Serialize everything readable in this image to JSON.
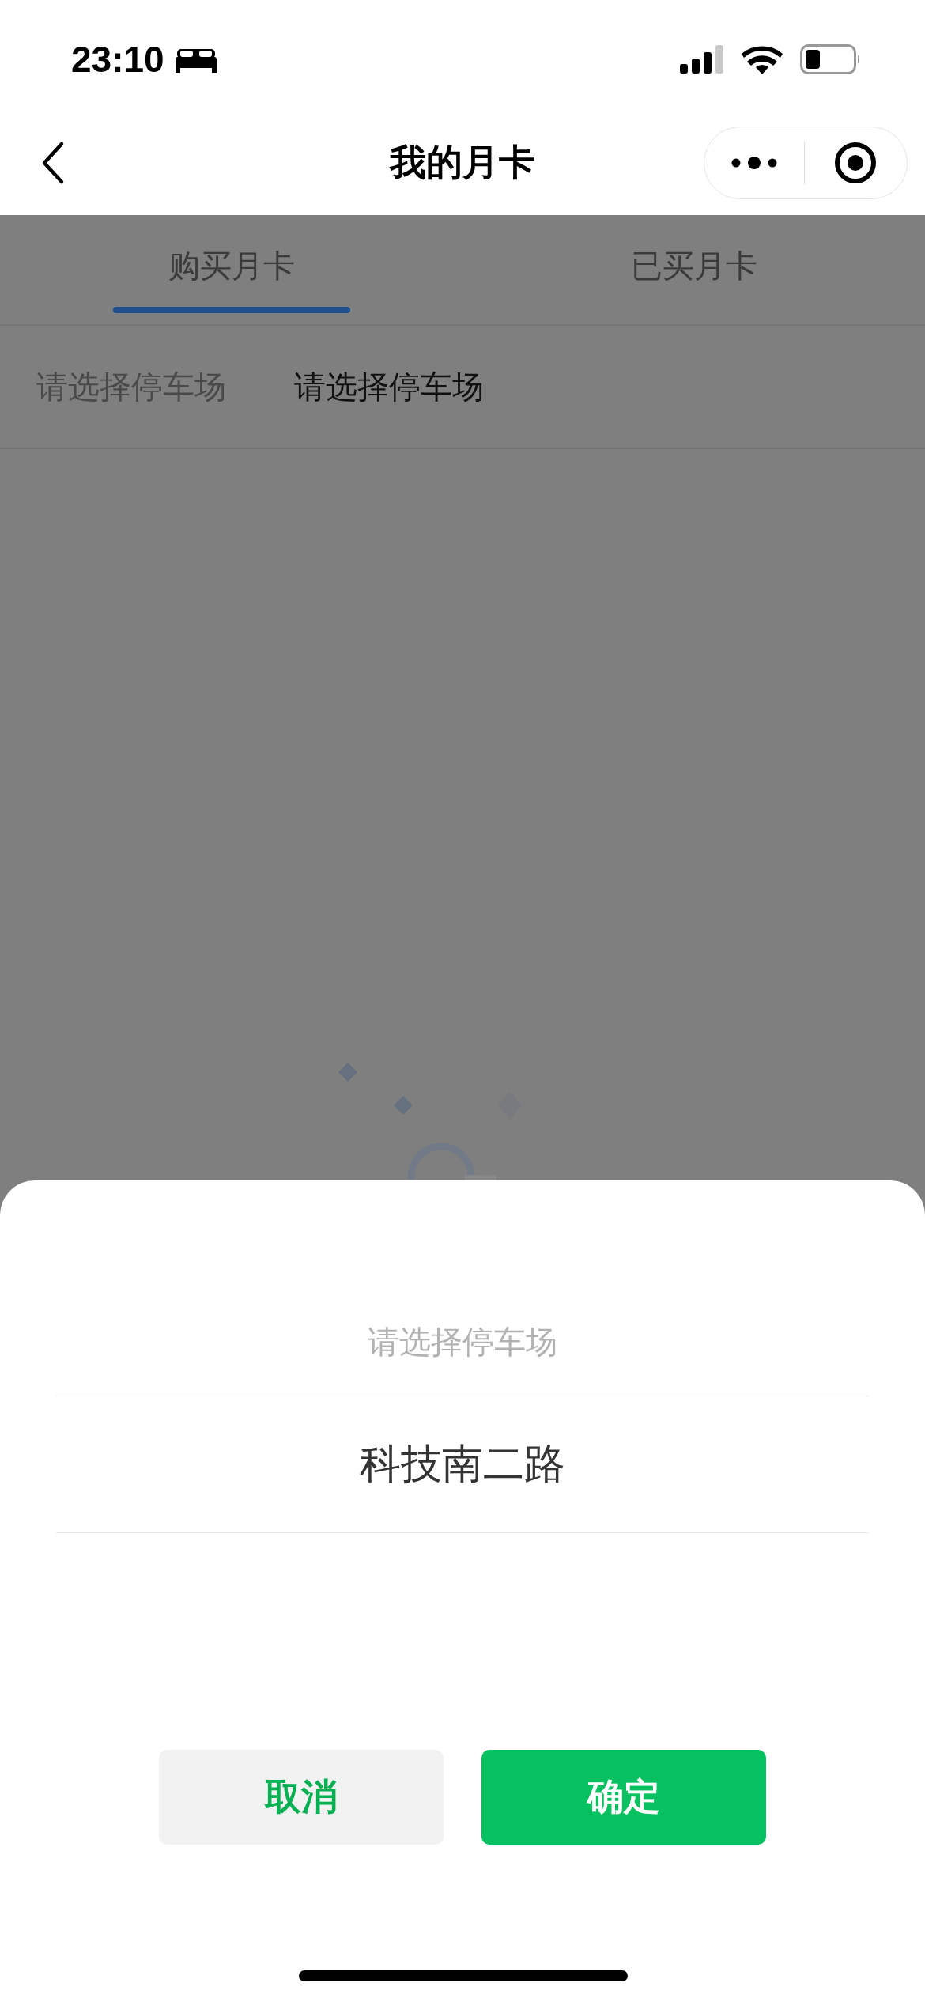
{
  "status_bar": {
    "time": "23:10"
  },
  "nav": {
    "title": "我的月卡"
  },
  "tabs": [
    {
      "label": "购买月卡",
      "selected": true
    },
    {
      "label": "已买月卡",
      "selected": false
    }
  ],
  "filters": [
    {
      "label": "请选择停车场",
      "kind": "label"
    },
    {
      "label": "请选择停车场",
      "kind": "value"
    }
  ],
  "picker": {
    "title": "请选择停车场",
    "options": [
      {
        "label": "科技南二路",
        "selected": true
      }
    ],
    "buttons": [
      {
        "label": "取消",
        "kind": "cancel"
      },
      {
        "label": "确定",
        "kind": "confirm"
      }
    ]
  }
}
